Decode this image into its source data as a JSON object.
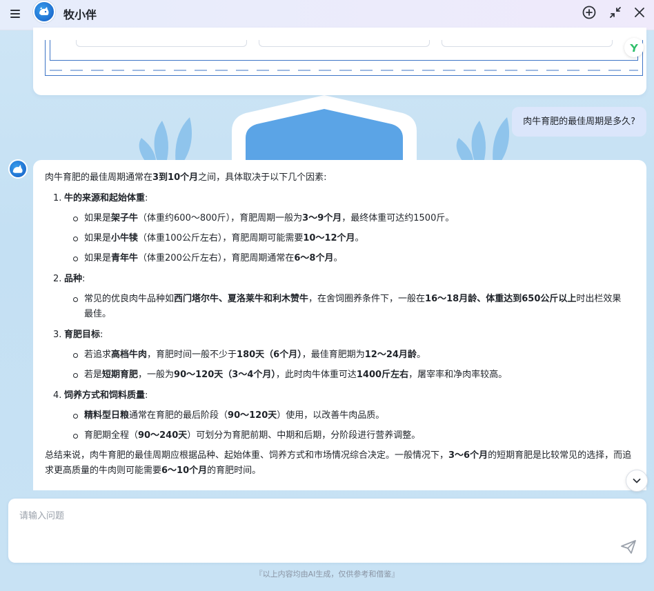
{
  "header": {
    "title": "牧小伴",
    "menu_icon": "hamburger-menu-icon",
    "new_chat_icon": "plus-circle-icon",
    "collapse_icon": "minimize-arrows-icon",
    "close_icon": "close-icon"
  },
  "chat": {
    "user_question": "肉牛育肥的最佳周期是多久?",
    "answer": {
      "intro": [
        "肉牛育肥的最佳周期通常在",
        "3到10个月",
        "之间，具体取决于以下几个因素:"
      ],
      "items": [
        {
          "num": "1.",
          "title": "牛的来源和起始体重",
          "colon": ":",
          "bullets": [
            [
              "如果是",
              "架子牛",
              "（体重约600～800斤），育肥周期一般为",
              "3～9个月",
              "，最终体重可达约1500斤。"
            ],
            [
              "如果是",
              "小牛犊",
              "（体重100公斤左右），育肥周期可能需要",
              "10～12个月",
              "。"
            ],
            [
              "如果是",
              "青年牛",
              "（体重200公斤左右），育肥周期通常在",
              "6～8个月",
              "。"
            ]
          ]
        },
        {
          "num": "2.",
          "title": "品种",
          "colon": ":",
          "bullets": [
            [
              "常见的优良肉牛品种如",
              "西门塔尔牛、夏洛莱牛和利木赞牛",
              "，在舍饲圈养条件下，一般在",
              "16～18月龄、体重达到650公斤以上",
              "时出栏效果最佳。"
            ]
          ]
        },
        {
          "num": "3.",
          "title": "育肥目标",
          "colon": ":",
          "bullets": [
            [
              "若追求",
              "高档牛肉",
              "，育肥时间一般不少于",
              "180天（6个月）",
              "，最佳育肥期为",
              "12～24月龄",
              "。"
            ],
            [
              "若是",
              "短期育肥",
              "，一般为",
              "90～120天（3～4个月）",
              "，此时肉牛体重可达",
              "1400斤左右",
              "，屠宰率和净肉率较高。"
            ]
          ]
        },
        {
          "num": "4.",
          "title": "饲养方式和饲料质量",
          "colon": ":",
          "bullets": [
            [
              "",
              "精料型日粮",
              "通常在育肥的最后阶段（",
              "90～120天",
              "）使用，以改善牛肉品质。"
            ],
            [
              "育肥期全程（",
              "90～240天",
              "）可划分为育肥前期、中期和后期，分阶段进行营养调整。"
            ]
          ]
        }
      ],
      "summary": [
        "总结来说，肉牛育肥的最佳周期应根据品种、起始体重、饲养方式和市场情况综合决定。一般情况下，",
        "3～6个月",
        "的短期育肥是比较常见的选择，而追求更高质量的牛肉则可能需要",
        "6～10个月",
        "的育肥时间。"
      ]
    }
  },
  "composer": {
    "placeholder": "请输入问题",
    "send_icon": "paper-plane-send-icon",
    "scroll_icon": "chevron-down-icon"
  },
  "footer": {
    "disclaimer": "『以上内容均由AI生成，仅供参考和借鉴』"
  },
  "colors": {
    "accent": "#3d74c6",
    "user_bubble": "#dbe6fb",
    "background": "#c8e2f4"
  }
}
